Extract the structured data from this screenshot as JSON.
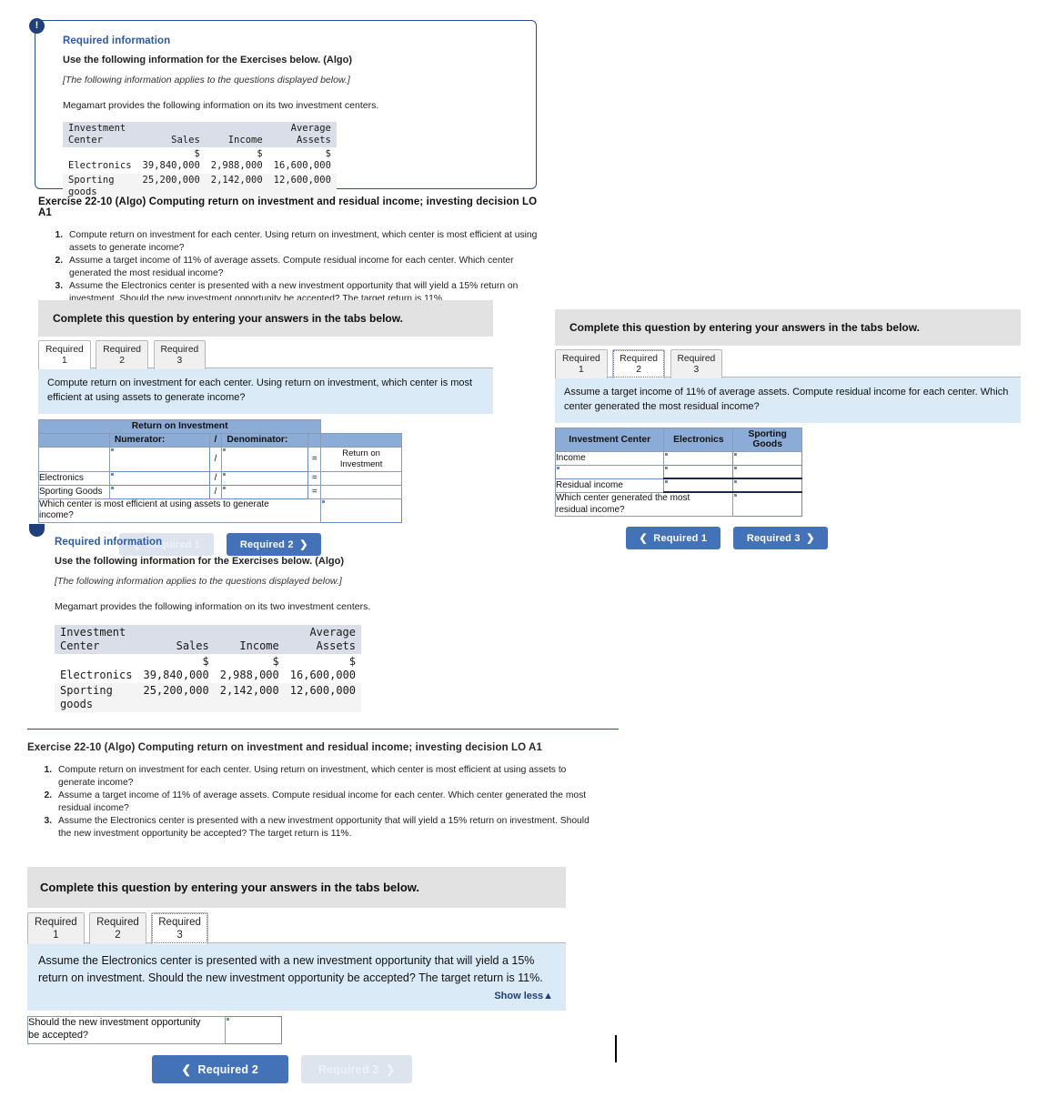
{
  "info_panel": {
    "badge": "!",
    "title": "Required information",
    "subtitle": "Use the following information for the Exercises below. (Algo)",
    "italic_note": "[The following information applies to the questions displayed below.]",
    "lead": "Megamart provides the following information on its two investment centers.",
    "table": {
      "headers": [
        "Investment\nCenter",
        "Sales",
        "Income",
        "Average\nAssets"
      ],
      "header_line1": [
        "Investment",
        "",
        "",
        "Average"
      ],
      "header_line2": [
        "Center",
        "Sales",
        "Income",
        "Assets"
      ],
      "rows": [
        {
          "center": "Electronics",
          "sales_symbol": "$",
          "sales": "39,840,000",
          "income_symbol": "$",
          "income": "2,988,000",
          "assets_symbol": "$",
          "assets": "16,600,000"
        },
        {
          "center_line1": "Sporting",
          "center_line2": "goods",
          "sales_symbol": "",
          "sales": "25,200,000",
          "income_symbol": "",
          "income": "2,142,000",
          "assets_symbol": "",
          "assets": "12,600,000"
        }
      ]
    }
  },
  "exercise": {
    "title": "Exercise 22-10 (Algo) Computing return on investment and residual income; investing decision LO A1",
    "questions": [
      "Compute return on investment for each center. Using return on investment, which center is most efficient at using assets to generate income?",
      "Assume a target income of 11% of average assets. Compute residual income for each center. Which center generated the most residual income?",
      "Assume the Electronics center is presented with a new investment opportunity that will yield a 15% return on investment. Should the new investment opportunity be accepted? The target return is 11%."
    ]
  },
  "complete_banner": "Complete this question by entering your answers in the tabs below.",
  "tabs": [
    {
      "line1": "Required",
      "line2": "1"
    },
    {
      "line1": "Required",
      "line2": "2"
    },
    {
      "line1": "Required",
      "line2": "3"
    }
  ],
  "panel_req1": {
    "active_tab": 1,
    "prompt": "Compute return on investment for each center. Using return on investment, which center is most efficient at using assets to generate income?",
    "table": {
      "title": "Return on Investment",
      "col_numerator": "Numerator:",
      "col_slash": "/",
      "col_denominator": "Denominator:",
      "result_label_line1": "Return on",
      "result_label_line2": "Investment",
      "op_slash": "/",
      "op_equals": "=",
      "rows": [
        {
          "label": "",
          "numerator": "",
          "denominator": "",
          "result": ""
        },
        {
          "label": "Electronics",
          "numerator": "",
          "denominator": "",
          "result": ""
        },
        {
          "label": "Sporting Goods",
          "numerator": "",
          "denominator": "",
          "result": ""
        }
      ],
      "footer_question_line1": "Which center is most efficient at using assets to generate",
      "footer_question_line2": "income?",
      "footer_answer": ""
    },
    "nav_prev": {
      "label": "Required 1",
      "chevron": "❮",
      "enabled": false
    },
    "nav_next": {
      "label": "Required 2",
      "chevron": "❯",
      "enabled": true
    }
  },
  "panel_req2": {
    "active_tab": 2,
    "complete_banner": "Complete this question by entering your answers in the tabs below.",
    "prompt": "Assume a target income of 11% of average assets. Compute residual income for each center. Which center generated the most residual income?",
    "table": {
      "headers": [
        "Investment Center",
        "Electronics",
        "Sporting\nGoods"
      ],
      "header_col1": "Investment Center",
      "header_col2": "Electronics",
      "header_col3_line1": "Sporting",
      "header_col3_line2": "Goods",
      "rows": [
        {
          "label": "Income",
          "electronics": "",
          "sporting": "",
          "label_is_input": false
        },
        {
          "label": "",
          "electronics": "",
          "sporting": "",
          "label_is_input": true
        },
        {
          "label": "Residual income",
          "electronics": "",
          "sporting": "",
          "label_is_input": false
        }
      ],
      "footer_question_line1": "Which center generated the most",
      "footer_question_line2": "residual income?",
      "footer_answer": ""
    },
    "nav_prev": {
      "label": "Required 1",
      "chevron": "❮",
      "enabled": true
    },
    "nav_next": {
      "label": "Required 3",
      "chevron": "❯",
      "enabled": true
    }
  },
  "panel_req3": {
    "active_tab": 3,
    "complete_banner": "Complete this question by entering your answers in the tabs below.",
    "prompt": "Assume the Electronics center is presented with a new investment opportunity that will yield a 15% return on investment. Should the new investment opportunity be accepted? The target return is 11%.",
    "show_less": "Show less",
    "show_less_arrow": "▲",
    "answer_row": {
      "label_line1": "Should the new investment opportunity",
      "label_line2": "be accepted?",
      "value": ""
    },
    "nav_prev": {
      "label": "Required 2",
      "chevron": "❮",
      "enabled": true
    },
    "nav_next": {
      "label": "Required 3",
      "chevron": "❯",
      "enabled": false
    }
  },
  "colors": {
    "accent_blue": "#2b5ba8",
    "table_header_blue": "#8cacd8",
    "prompt_blue": "#dbeaf7",
    "banner_gray": "#e2e2e2",
    "button_blue": "#4472b8",
    "button_disabled": "#dde4ee",
    "border_navy": "#2b4f8e"
  }
}
